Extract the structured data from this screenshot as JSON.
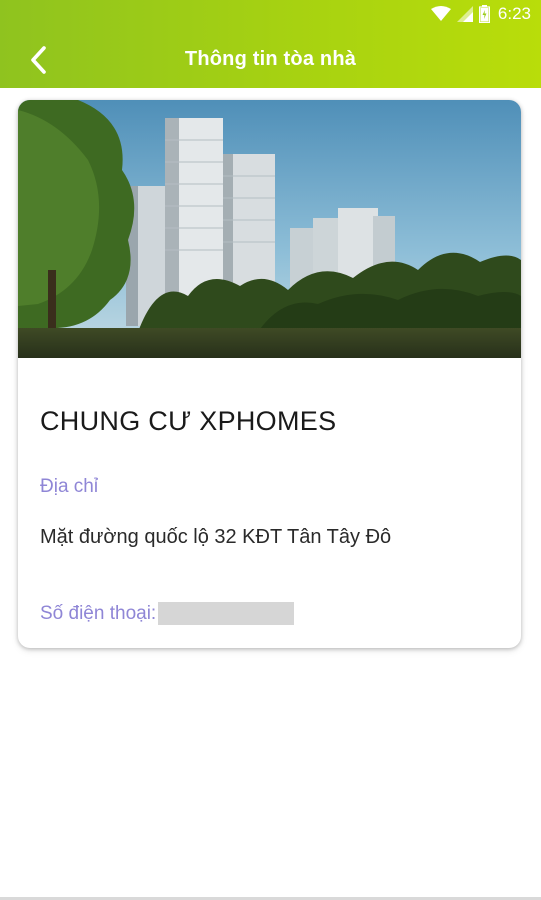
{
  "status_bar": {
    "time": "6:23",
    "icons": [
      "wifi-icon",
      "cell-signal-icon",
      "battery-icon"
    ]
  },
  "app_bar": {
    "title": "Thông tin tòa nhà",
    "back_icon": "chevron-left-icon",
    "color": "#a7d211"
  },
  "building": {
    "name": "CHUNG CƯ XPHOMES",
    "address_label": "Địa chỉ",
    "address": "Mặt đường quốc lộ 32 KĐT Tân Tây Đô",
    "phone_label": "Số điện thoại:",
    "phone": ""
  },
  "colors": {
    "label": "#8f86d6",
    "accent": "#a7d211"
  }
}
